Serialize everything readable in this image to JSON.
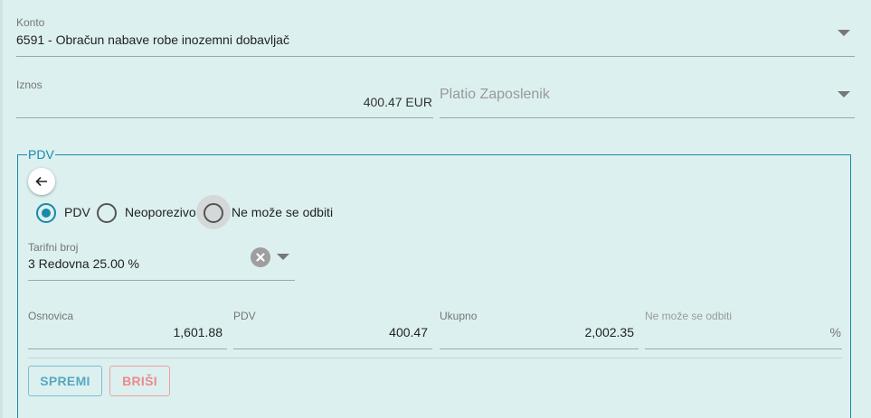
{
  "konto": {
    "label": "Konto",
    "value": "6591 - Obračun nabave robe inozemni dobavljač"
  },
  "iznos": {
    "label": "Iznos",
    "value": "400.47 EUR"
  },
  "platio": {
    "placeholder": "Platio Zaposlenik"
  },
  "pdv_section": {
    "legend": "PDV",
    "radios": [
      {
        "label": "PDV",
        "checked": true
      },
      {
        "label": "Neoporezivo",
        "checked": false
      },
      {
        "label": "Ne može se odbiti",
        "checked": false
      }
    ],
    "tarifni_broj": {
      "label": "Tarifni broj",
      "value": "3 Redovna 25.00 %"
    },
    "amounts": [
      {
        "label": "Osnovica",
        "value": "1,601.88"
      },
      {
        "label": "PDV",
        "value": "400.47"
      },
      {
        "label": "Ukupno",
        "value": "2,002.35"
      },
      {
        "label": "Ne može se odbiti",
        "value": "%"
      }
    ],
    "buttons": {
      "save": "SPREMI",
      "delete": "BRIŠI"
    }
  },
  "colors": {
    "accent": "#1a8aa6",
    "delete": "#ee8a8a",
    "background": "#dcf0f0"
  },
  "icons": [
    "dropdown-arrow-icon",
    "back-arrow-icon",
    "clear-icon"
  ]
}
